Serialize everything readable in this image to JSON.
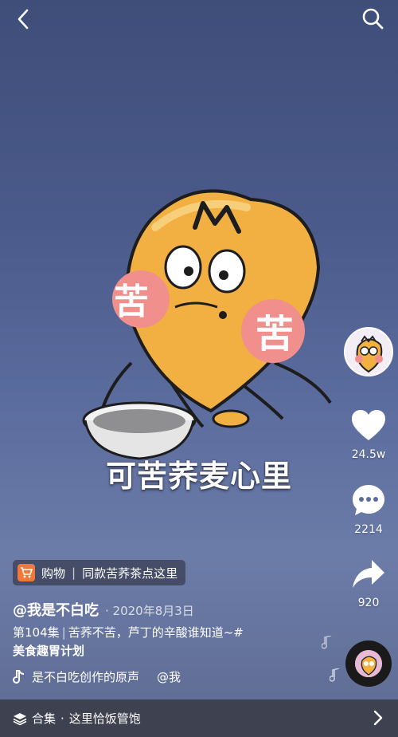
{
  "caption": "可苦荞麦心里",
  "cheek_text": "苦",
  "rail": {
    "likes": "24.5w",
    "comments": "2214",
    "shares": "920"
  },
  "shop": {
    "label": "购物",
    "text": "同款苦荞茶点这里"
  },
  "author": {
    "handle": "@我是不白吃",
    "date": "· 2020年8月3日"
  },
  "description": {
    "episode": "第104集",
    "sep": "|",
    "text": "苦荞不苦，芦丁的辛酸谁知道~#",
    "tag": "美食趣胃计划"
  },
  "music": {
    "title": "是不白吃创作的原声",
    "mention": "@我"
  },
  "collection": {
    "label": "合集",
    "dot": "·",
    "name": "这里恰饭管饱"
  },
  "colors": {
    "shop_accent": "#f0793a",
    "cheek": "#f08f8c",
    "body": "#f2b043"
  }
}
